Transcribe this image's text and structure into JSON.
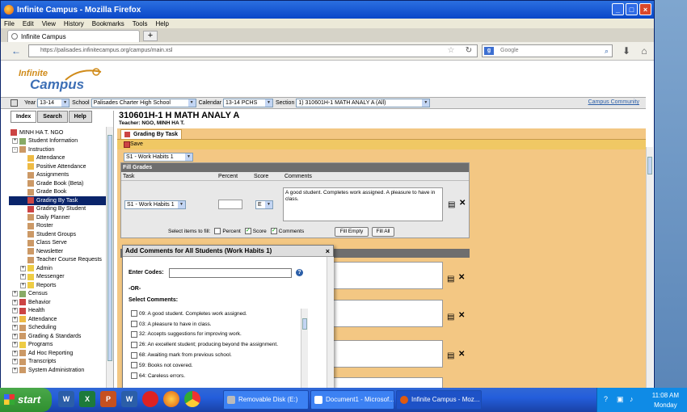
{
  "window": {
    "title": "Infinite Campus - Mozilla Firefox"
  },
  "menu": [
    "File",
    "Edit",
    "View",
    "History",
    "Bookmarks",
    "Tools",
    "Help"
  ],
  "browser_tab": {
    "label": "Infinite Campus",
    "new_tab": "+"
  },
  "nav": {
    "url": "https://palisades.infinitecampus.org/campus/main.xsl",
    "search_placeholder": "Google",
    "search_engine": "g"
  },
  "logo": {
    "line1": "Infinite",
    "line2": "Campus"
  },
  "context": {
    "year_label": "Year",
    "year": "13-14",
    "school_label": "School",
    "school": "Palisades Charter High School",
    "calendar_label": "Calendar",
    "calendar": "13-14 PCHS",
    "section_label": "Section",
    "section": "1) 310601H-1 MATH ANALY A (All)",
    "community": "Campus Community"
  },
  "left_tabs": [
    "Index",
    "Search",
    "Help"
  ],
  "tree": [
    {
      "label": "MINH HA T. NGO",
      "level": 0,
      "pm": "",
      "color": "#c44"
    },
    {
      "label": "Student Information",
      "level": 1,
      "pm": "+",
      "color": "#8a6"
    },
    {
      "label": "Instruction",
      "level": 1,
      "pm": "-",
      "color": "#c96"
    },
    {
      "label": "Attendance",
      "level": 2,
      "pm": "",
      "color": "#eb4"
    },
    {
      "label": "Positive Attendance",
      "level": 2,
      "pm": "",
      "color": "#eb4"
    },
    {
      "label": "Assignments",
      "level": 2,
      "pm": "",
      "color": "#c96"
    },
    {
      "label": "Grade Book (Beta)",
      "level": 2,
      "pm": "",
      "color": "#c96"
    },
    {
      "label": "Grade Book",
      "level": 2,
      "pm": "",
      "color": "#c96"
    },
    {
      "label": "Grading By Task",
      "level": 2,
      "pm": "",
      "color": "#c44",
      "selected": true
    },
    {
      "label": "Grading By Student",
      "level": 2,
      "pm": "",
      "color": "#c44"
    },
    {
      "label": "Daily Planner",
      "level": 2,
      "pm": "",
      "color": "#c96"
    },
    {
      "label": "Roster",
      "level": 2,
      "pm": "",
      "color": "#c96"
    },
    {
      "label": "Student Groups",
      "level": 2,
      "pm": "",
      "color": "#c96"
    },
    {
      "label": "Class Serve",
      "level": 2,
      "pm": "",
      "color": "#c96"
    },
    {
      "label": "Newsletter",
      "level": 2,
      "pm": "",
      "color": "#c96"
    },
    {
      "label": "Teacher Course Requests",
      "level": 2,
      "pm": "",
      "color": "#c96"
    },
    {
      "label": "Admin",
      "level": 2,
      "pm": "+",
      "color": "#ec4"
    },
    {
      "label": "Messenger",
      "level": 2,
      "pm": "+",
      "color": "#ec4"
    },
    {
      "label": "Reports",
      "level": 2,
      "pm": "+",
      "color": "#ec4"
    },
    {
      "label": "Census",
      "level": 1,
      "pm": "+",
      "color": "#8a6"
    },
    {
      "label": "Behavior",
      "level": 1,
      "pm": "+",
      "color": "#c44"
    },
    {
      "label": "Health",
      "level": 1,
      "pm": "+",
      "color": "#c44"
    },
    {
      "label": "Attendance",
      "level": 1,
      "pm": "+",
      "color": "#eb4"
    },
    {
      "label": "Scheduling",
      "level": 1,
      "pm": "+",
      "color": "#c96"
    },
    {
      "label": "Grading & Standards",
      "level": 1,
      "pm": "+",
      "color": "#c96"
    },
    {
      "label": "Programs",
      "level": 1,
      "pm": "+",
      "color": "#ec4"
    },
    {
      "label": "Ad Hoc Reporting",
      "level": 1,
      "pm": "+",
      "color": "#c96"
    },
    {
      "label": "Transcripts",
      "level": 1,
      "pm": "+",
      "color": "#c96"
    },
    {
      "label": "System Administration",
      "level": 1,
      "pm": "+",
      "color": "#c96"
    }
  ],
  "main": {
    "section_title": "310601H-1 H MATH ANALY A",
    "teacher": "Teacher: NGO, MINH HA T.",
    "tab": "Grading By Task",
    "save": "Save",
    "term_select": "S1 - Work Habits 1"
  },
  "fill_grades": {
    "heading": "Fill Grades",
    "columns": [
      "Task",
      "Percent",
      "Score",
      "Comments"
    ],
    "task": "S1 - Work Habits 1",
    "score": "E",
    "comment": "A good student. Completes work assigned.  A pleasure to have in class.",
    "select_label": "Select items to fill:",
    "opt_percent": "Percent",
    "opt_score": "Score",
    "opt_comments": "Comments",
    "fill_empty": "Fill Empty",
    "fill_all": "Fill All"
  },
  "modal": {
    "title": "Add Comments for All Students (Work Habits 1)",
    "close": "×",
    "enter_codes": "Enter Codes:",
    "or": "-OR-",
    "select_comments": "Select Comments:",
    "help": "?",
    "comments": [
      "09: A good student. Completes work assigned.",
      "03: A pleasure to have in class.",
      "32: Accepts suggestions for improving work.",
      "26: An excellent student; producing beyond the assignment.",
      "68: Awaiting mark from previous school.",
      "59: Books not covered.",
      "64: Careless errors."
    ]
  },
  "taskbar": {
    "start": "start",
    "quick": [
      "W",
      "X",
      "P",
      "W"
    ],
    "tasks": [
      "Removable Disk (E:)",
      "Document1 - Microsof...",
      "Infinite Campus - Moz..."
    ],
    "time": "11:08 AM",
    "day": "Monday"
  }
}
